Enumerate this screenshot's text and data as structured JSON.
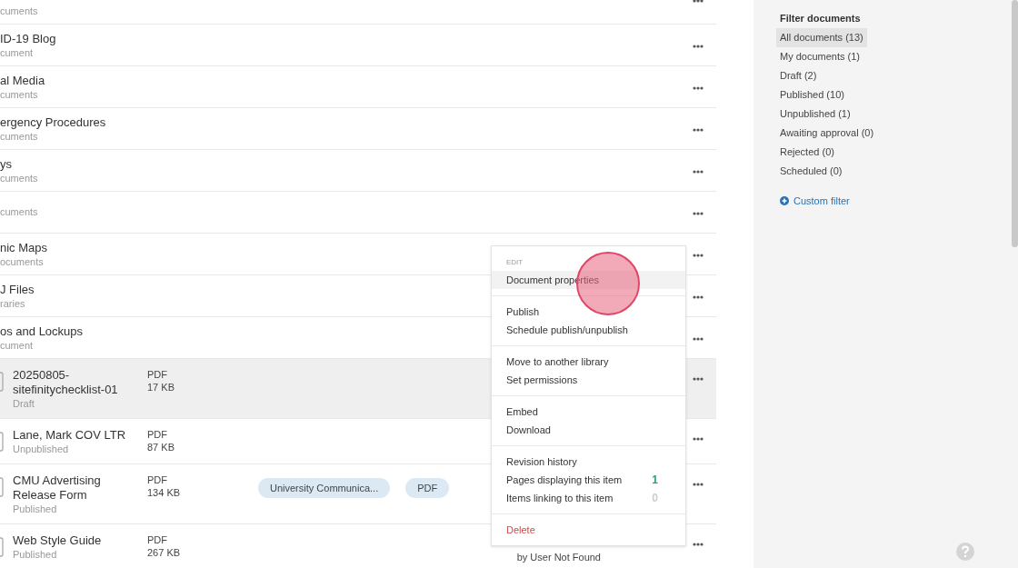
{
  "list": {
    "rows": [
      {
        "kind": "folder",
        "subtitle": "cuments",
        "selected": false
      },
      {
        "kind": "folder",
        "title": "ID-19 Blog",
        "subtitle": "cument",
        "selected": false
      },
      {
        "kind": "folder",
        "title": "al Media",
        "subtitle": "cuments",
        "selected": false
      },
      {
        "kind": "folder",
        "title": "ergency Procedures",
        "subtitle": "cuments",
        "selected": false
      },
      {
        "kind": "folder",
        "title": "ys",
        "subtitle": "cuments",
        "selected": false
      },
      {
        "kind": "folder",
        "subtitle": "cuments",
        "selected": false
      },
      {
        "kind": "folder",
        "title": "nic Maps",
        "subtitle": "ocuments",
        "selected": false
      },
      {
        "kind": "folder",
        "title": "J Files",
        "subtitle": "raries",
        "selected": false
      },
      {
        "kind": "folder",
        "title": "os and Lockups",
        "subtitle": "cument",
        "selected": false
      },
      {
        "kind": "document",
        "title": "20250805-sitefinitychecklist-01",
        "status": "Draft",
        "type": "PDF",
        "size": "17 KB",
        "tags": [],
        "selected": true
      },
      {
        "kind": "document",
        "title": "Lane, Mark COV LTR",
        "status": "Unpublished",
        "type": "PDF",
        "size": "87 KB",
        "tags": [],
        "selected": false
      },
      {
        "kind": "document",
        "title": "CMU Advertising Release Form",
        "status": "Published",
        "type": "PDF",
        "size": "134 KB",
        "tags": [
          "University Communica...",
          "PDF"
        ],
        "selected": false
      },
      {
        "kind": "document",
        "title": "Web Style Guide",
        "status": "Published",
        "type": "PDF",
        "size": "267 KB",
        "tags": [],
        "owner": "by User Not Found",
        "selected": false
      }
    ]
  },
  "context_menu": {
    "sections": [
      {
        "heading": "EDIT",
        "items": [
          {
            "label": "Document properties",
            "kind": "action",
            "selected": true
          }
        ]
      },
      {
        "items": [
          {
            "label": "Publish",
            "kind": "action",
            "selected": false
          },
          {
            "label": "Schedule publish/unpublish",
            "kind": "action",
            "selected": false
          }
        ]
      },
      {
        "items": [
          {
            "label": "Move to another library",
            "kind": "action",
            "selected": false
          },
          {
            "label": "Set permissions",
            "kind": "action",
            "selected": false
          }
        ]
      },
      {
        "items": [
          {
            "label": "Embed",
            "kind": "action",
            "selected": false
          },
          {
            "label": "Download",
            "kind": "action",
            "selected": false
          }
        ]
      },
      {
        "items": [
          {
            "label": "Revision history",
            "kind": "action",
            "selected": false
          },
          {
            "label": "Pages displaying this item",
            "kind": "action",
            "selected": false,
            "count": "1",
            "color": "#2e9e7a"
          },
          {
            "label": "Items linking to this item",
            "kind": "action",
            "selected": false,
            "count": "0",
            "color": "#cccccc"
          }
        ]
      },
      {
        "items": [
          {
            "label": "Delete",
            "kind": "danger",
            "selected": false
          }
        ]
      }
    ]
  },
  "filter_panel": {
    "title": "Filter documents",
    "items": [
      {
        "label": "All documents (13)",
        "selected": true
      },
      {
        "label": "My documents (1)",
        "selected": false
      },
      {
        "label": "Draft (2)",
        "selected": false
      },
      {
        "label": "Published (10)",
        "selected": false
      },
      {
        "label": "Unpublished (1)",
        "selected": false
      },
      {
        "label": "Awaiting approval (0)",
        "selected": false
      },
      {
        "label": "Rejected (0)",
        "selected": false
      },
      {
        "label": "Scheduled (0)",
        "selected": false
      }
    ],
    "custom_filter": "Custom filter"
  }
}
